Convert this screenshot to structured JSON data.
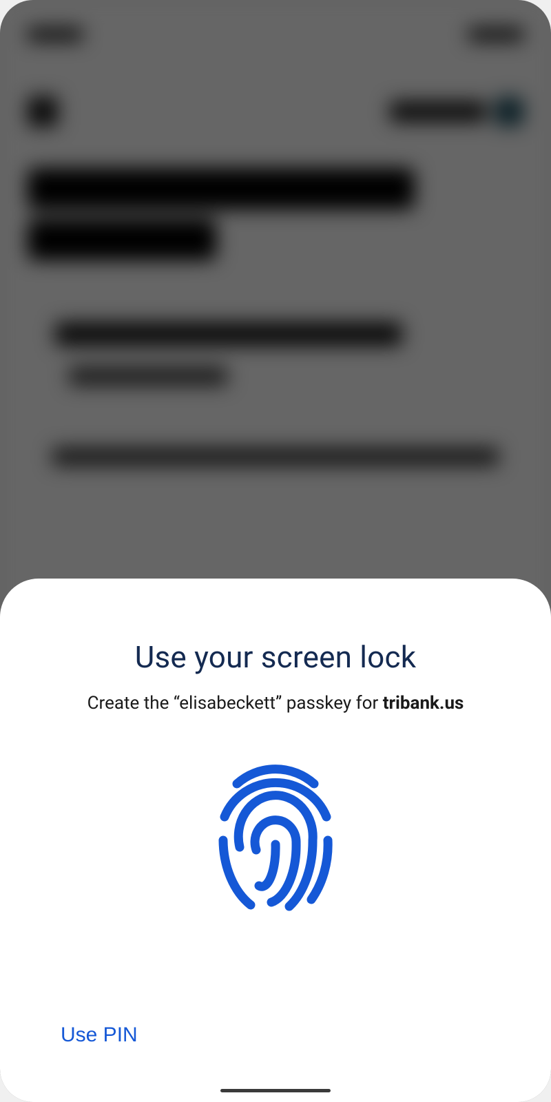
{
  "sheet": {
    "title": "Use your screen lock",
    "subtitle_prefix": "Create the “",
    "subtitle_username": "elisabeckett",
    "subtitle_mid": "” passkey for ",
    "subtitle_domain": "tribank.us",
    "use_pin_label": "Use PIN"
  },
  "colors": {
    "accent": "#1558d6",
    "title": "#142a51"
  }
}
